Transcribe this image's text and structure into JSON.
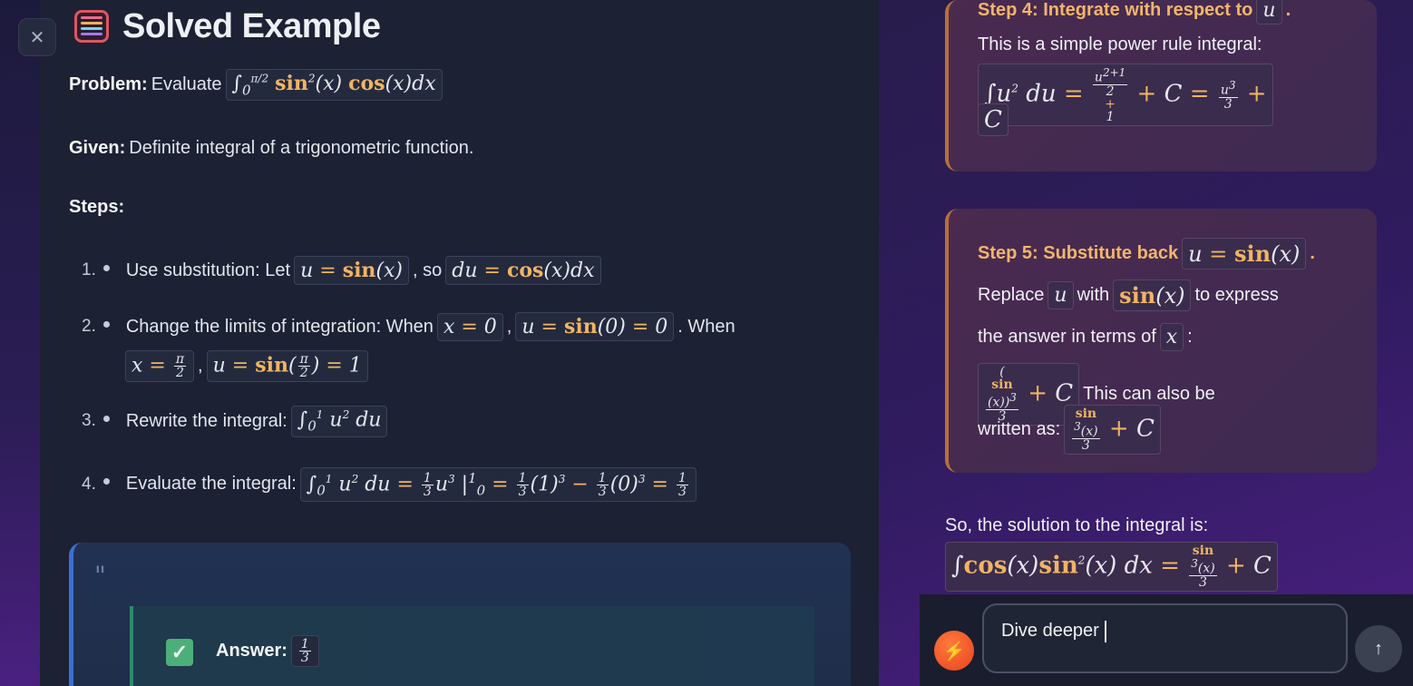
{
  "title": "Solved Example",
  "problem_label": "Problem:",
  "problem_text": "Evaluate",
  "given_label": "Given:",
  "given_text": "Definite integral of a trigonometric function.",
  "steps_label": "Steps:",
  "steps": [
    {
      "num": "1.",
      "text_a": "Use substitution: Let",
      "text_b": ", so"
    },
    {
      "num": "2.",
      "text_a": "Change the limits of integration: When",
      "text_b": ",",
      "text_c": ". When",
      "text_d": ","
    },
    {
      "num": "3.",
      "text_a": "Rewrite the integral:"
    },
    {
      "num": "4.",
      "text_a": "Evaluate the integral:"
    }
  ],
  "answer_label": "Answer:",
  "step4": {
    "heading": "Step 4: Integrate with respect to",
    "heading_end": ".",
    "text": "This is a simple power rule integral:"
  },
  "step5": {
    "heading": "Step 5: Substitute back",
    "heading_end": ".",
    "t1": "Replace",
    "t2": "with",
    "t3": "to express",
    "t4": "the answer in terms of",
    "t5": ":",
    "t6": "This can also be",
    "t7": "written as:"
  },
  "solution_text": "So, the solution to the integral is:",
  "input": {
    "value": "Dive deeper"
  },
  "icons": {
    "close": "close-icon",
    "bolt": "bolt-icon",
    "send": "arrow-up-icon",
    "abacus": "abacus-icon",
    "check": "check-icon",
    "quote": "quote-icon"
  },
  "colors": {
    "accent": "#f0b463",
    "answer_green": "#4caf7a",
    "bolt": "#e8421f"
  }
}
